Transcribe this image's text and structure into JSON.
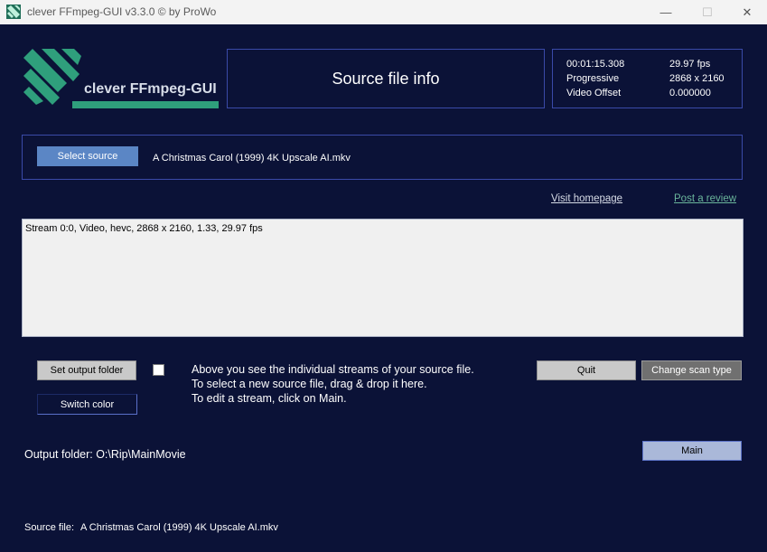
{
  "window": {
    "title": "clever FFmpeg-GUI v3.3.0   © by ProWo",
    "minimize_glyph": "—",
    "maximize_glyph": "☐",
    "close_glyph": "✕",
    "icon": "app-logo-icon"
  },
  "header": {
    "logo_text": "clever FFmpeg-GUI",
    "section_title": "Source file info",
    "info": {
      "duration": "00:01:15.308",
      "fps": "29.97 fps",
      "scan_type": "Progressive",
      "resolution": "2868 x 2160",
      "offset_label": "Video Offset",
      "offset_value": "0.000000"
    }
  },
  "source": {
    "select_label": "Select source",
    "file_name": "A Christmas Carol (1999) 4K Upscale AI.mkv"
  },
  "links": {
    "visit_homepage": "Visit homepage",
    "post_review": "Post a review"
  },
  "streams": [
    "Stream 0:0, Video, hevc, 2868 x 2160, 1.33, 29.97 fps"
  ],
  "controls": {
    "set_output_label": "Set output folder",
    "switch_color_label": "Switch color",
    "help_line1": "Above you see the individual streams of your source file.",
    "help_line2": "To select a new source file, drag & drop it here.",
    "help_line3": "To edit a stream, click on Main.",
    "quit_label": "Quit",
    "change_scan_label": "Change scan type",
    "main_label": "Main"
  },
  "output_folder": "Output folder: O:\\Rip\\MainMovie",
  "footer": {
    "label": "Source file:",
    "value": "A Christmas Carol (1999) 4K Upscale AI.mkv"
  },
  "colors": {
    "background": "#0b1237",
    "border_accent": "#3a4aa8",
    "logo_green": "#2f9f7c",
    "select_button": "#5b86c5",
    "link_review": "#6ab59b"
  }
}
